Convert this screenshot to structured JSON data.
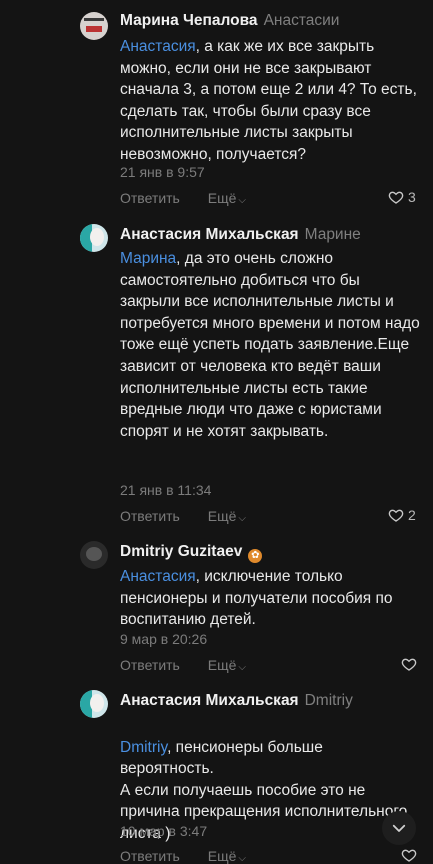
{
  "comments": [
    {
      "author": "Марина Чепалова",
      "reply_to": "Анастасии",
      "mention": "Анастасия",
      "text": ", а как же их все закрыть можно, если они не все закрывают сначала 3, а потом еще 2 или 4? То есть, сделать так, чтобы были сразу все исполнительные листы закрыты невозможно, получается?",
      "time": "21 янв в 9:57",
      "reply_label": "Ответить",
      "more_label": "Ещё",
      "likes": "3",
      "avatar": "news-avatar"
    },
    {
      "author": "Анастасия Михальская",
      "reply_to": "Марине",
      "mention": "Марина",
      "text": ", да это очень сложно самостоятельно добиться что бы закрыли все исполнительные листы и потребуется много времени и потом надо тоже ещё успеть подать заявление.Еще зависит от человека кто ведёт ваши исполнительные листы есть такие вредные люди что даже с юристами спорят и не хотят закрывать.",
      "time": "21 янв в 11:34",
      "reply_label": "Ответить",
      "more_label": "Ещё",
      "likes": "2",
      "avatar": "profile-avatar"
    },
    {
      "author": "Dmitriy Guzitaev",
      "reply_to": "",
      "mention": "Анастасия",
      "text": ", исключение только пенсионеры и получатели пособия по воспитанию детей.",
      "time": "9 мар в 20:26",
      "reply_label": "Ответить",
      "more_label": "Ещё",
      "likes": "",
      "avatar": "profile-avatar"
    },
    {
      "author": "Анастасия Михальская",
      "reply_to": "Dmitriy",
      "mention": "Dmitriy",
      "text": ", пенсионеры больше вероятность.\nА если получаешь пособие это не причина прекращения исполнительного листа )",
      "time": "10 мар в 3:47",
      "reply_label": "Ответить",
      "more_label": "Ещё",
      "likes": "",
      "avatar": "profile-avatar"
    }
  ],
  "icons": {
    "like": "heart-icon",
    "more": "chevron-down-icon",
    "scroll": "chevron-down-icon"
  },
  "colors": {
    "background": "#141414",
    "mention": "#4a8fe0",
    "muted": "#7c7c7c"
  }
}
